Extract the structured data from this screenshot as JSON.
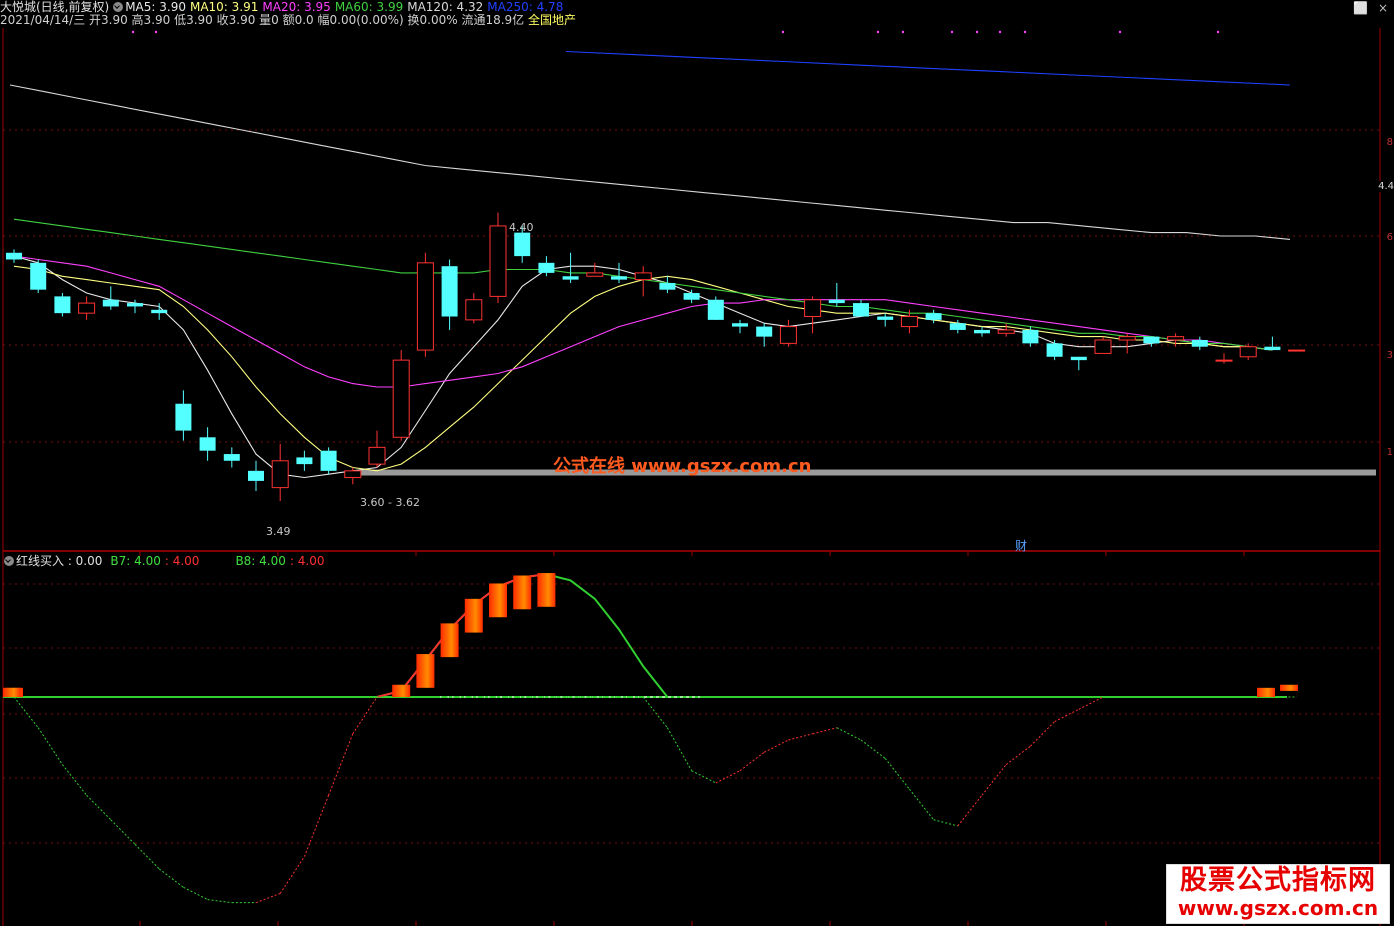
{
  "header": {
    "stock_name": "大悦城(日线,前复权)",
    "ma5": "MA5: 3.90",
    "ma10": "MA10: 3.91",
    "ma20": "MA20: 3.95",
    "ma60": "MA60: 3.99",
    "ma120": "MA120: 4.32",
    "ma250": "MA250: 4.78",
    "info_line": "2021/04/14/三 开3.90 高3.90 低3.90 收3.90 量0 额0.0 幅0.00(0.00%) 换0.00% 流通18.9亿",
    "sector": "全国地产"
  },
  "window_controls": {
    "restore": "⬜",
    "close": "×"
  },
  "price_annotations": {
    "high": "4.40",
    "low": "3.49",
    "range": "3.60 - 3.62",
    "current": "4.4",
    "finance_mark": "财"
  },
  "watermark": "公式在线  www.gszx.com.cn",
  "logo": {
    "line1": "股票公式指标网",
    "line2": "www.gszx.com.cn"
  },
  "indicator_header": {
    "name": "红线买入 : 0.00",
    "b7": "B7: 4.00",
    "b7_val": ": 4.00",
    "b8": "B8: 4.00",
    "b8_val": ": 4.00"
  },
  "right_ticks": [
    "8",
    "6",
    "3",
    "1"
  ],
  "colors": {
    "up": "#ff3232",
    "down": "#54ffff",
    "ma5": "#e8e8e8",
    "ma10": "#ffff80",
    "ma20": "#ff40ff",
    "ma60": "#40d040",
    "ma120": "#d8d8d8",
    "ma250": "#2040ff",
    "sector": "#ffff60"
  },
  "chart_data": {
    "type": "candlestick",
    "candles": [
      {
        "o": 4.28,
        "c": 4.26,
        "h": 4.29,
        "l": 4.25
      },
      {
        "o": 4.25,
        "c": 4.17,
        "h": 4.26,
        "l": 4.16
      },
      {
        "o": 4.15,
        "c": 4.1,
        "h": 4.16,
        "l": 4.09
      },
      {
        "o": 4.1,
        "c": 4.13,
        "h": 4.15,
        "l": 4.08
      },
      {
        "o": 4.14,
        "c": 4.12,
        "h": 4.18,
        "l": 4.11
      },
      {
        "o": 4.13,
        "c": 4.12,
        "h": 4.14,
        "l": 4.1
      },
      {
        "o": 4.11,
        "c": 4.1,
        "h": 4.13,
        "l": 4.08
      },
      {
        "o": 3.83,
        "c": 3.75,
        "h": 3.87,
        "l": 3.72
      },
      {
        "o": 3.73,
        "c": 3.69,
        "h": 3.76,
        "l": 3.66
      },
      {
        "o": 3.68,
        "c": 3.66,
        "h": 3.7,
        "l": 3.64
      },
      {
        "o": 3.63,
        "c": 3.6,
        "h": 3.66,
        "l": 3.57
      },
      {
        "o": 3.58,
        "c": 3.66,
        "h": 3.71,
        "l": 3.54
      },
      {
        "o": 3.67,
        "c": 3.65,
        "h": 3.69,
        "l": 3.63
      },
      {
        "o": 3.69,
        "c": 3.63,
        "h": 3.7,
        "l": 3.62
      },
      {
        "o": 3.61,
        "c": 3.63,
        "h": 3.64,
        "l": 3.59
      },
      {
        "o": 3.65,
        "c": 3.7,
        "h": 3.75,
        "l": 3.64
      },
      {
        "o": 3.73,
        "c": 3.96,
        "h": 3.99,
        "l": 3.72
      },
      {
        "o": 3.99,
        "c": 4.25,
        "h": 4.28,
        "l": 3.97
      },
      {
        "o": 4.24,
        "c": 4.09,
        "h": 4.26,
        "l": 4.05
      },
      {
        "o": 4.08,
        "c": 4.14,
        "h": 4.16,
        "l": 4.07
      },
      {
        "o": 4.15,
        "c": 4.36,
        "h": 4.4,
        "l": 4.13
      },
      {
        "o": 4.34,
        "c": 4.27,
        "h": 4.36,
        "l": 4.25
      },
      {
        "o": 4.25,
        "c": 4.22,
        "h": 4.27,
        "l": 4.21
      },
      {
        "o": 4.21,
        "c": 4.2,
        "h": 4.28,
        "l": 4.19
      },
      {
        "o": 4.21,
        "c": 4.22,
        "h": 4.25,
        "l": 4.21
      },
      {
        "o": 4.21,
        "c": 4.2,
        "h": 4.25,
        "l": 4.19
      },
      {
        "o": 4.2,
        "c": 4.22,
        "h": 4.24,
        "l": 4.15
      },
      {
        "o": 4.19,
        "c": 4.17,
        "h": 4.21,
        "l": 4.16
      },
      {
        "o": 4.16,
        "c": 4.14,
        "h": 4.17,
        "l": 4.13
      },
      {
        "o": 4.14,
        "c": 4.08,
        "h": 4.15,
        "l": 4.08
      },
      {
        "o": 4.07,
        "c": 4.06,
        "h": 4.08,
        "l": 4.04
      },
      {
        "o": 4.06,
        "c": 4.03,
        "h": 4.07,
        "l": 4.0
      },
      {
        "o": 4.01,
        "c": 4.06,
        "h": 4.08,
        "l": 4.0
      },
      {
        "o": 4.09,
        "c": 4.14,
        "h": 4.15,
        "l": 4.04
      },
      {
        "o": 4.14,
        "c": 4.13,
        "h": 4.19,
        "l": 4.12
      },
      {
        "o": 4.13,
        "c": 4.09,
        "h": 4.14,
        "l": 4.09
      },
      {
        "o": 4.09,
        "c": 4.08,
        "h": 4.1,
        "l": 4.06
      },
      {
        "o": 4.06,
        "c": 4.09,
        "h": 4.11,
        "l": 4.04
      },
      {
        "o": 4.1,
        "c": 4.08,
        "h": 4.11,
        "l": 4.07
      },
      {
        "o": 4.07,
        "c": 4.05,
        "h": 4.08,
        "l": 4.04
      },
      {
        "o": 4.05,
        "c": 4.04,
        "h": 4.06,
        "l": 4.03
      },
      {
        "o": 4.04,
        "c": 4.05,
        "h": 4.07,
        "l": 4.03
      },
      {
        "o": 4.05,
        "c": 4.01,
        "h": 4.06,
        "l": 4.0
      },
      {
        "o": 4.01,
        "c": 3.97,
        "h": 4.02,
        "l": 3.96
      },
      {
        "o": 3.97,
        "c": 3.96,
        "h": 3.97,
        "l": 3.93
      },
      {
        "o": 3.98,
        "c": 4.02,
        "h": 4.03,
        "l": 3.98
      },
      {
        "o": 4.02,
        "c": 4.03,
        "h": 4.04,
        "l": 3.98
      },
      {
        "o": 4.03,
        "c": 4.01,
        "h": 4.03,
        "l": 4.0
      },
      {
        "o": 4.02,
        "c": 4.03,
        "h": 4.04,
        "l": 4.0
      },
      {
        "o": 4.02,
        "c": 4.0,
        "h": 4.03,
        "l": 3.99
      },
      {
        "o": 3.96,
        "c": 3.96,
        "h": 3.98,
        "l": 3.95
      },
      {
        "o": 3.97,
        "c": 4.0,
        "h": 4.01,
        "l": 3.96
      },
      {
        "o": 4.0,
        "c": 3.99,
        "h": 4.03,
        "l": 3.99
      },
      {
        "o": 3.99,
        "c": 3.99,
        "h": 3.99,
        "l": 3.99
      }
    ],
    "ma_series": [
      {
        "name": "MA5",
        "values": [
          4.27,
          4.25,
          4.2,
          4.16,
          4.14,
          4.13,
          4.12,
          4.05,
          3.93,
          3.8,
          3.68,
          3.62,
          3.61,
          3.62,
          3.63,
          3.64,
          3.7,
          3.81,
          3.92,
          4.0,
          4.08,
          4.18,
          4.23,
          4.24,
          4.24,
          4.23,
          4.21,
          4.19,
          4.16,
          4.13,
          4.1,
          4.07,
          4.06,
          4.07,
          4.08,
          4.09,
          4.1,
          4.09,
          4.08,
          4.07,
          4.06,
          4.05,
          4.04,
          4.01,
          4.0,
          4.0,
          4.0,
          4.01,
          4.02,
          4.01,
          4.0,
          4.0,
          3.99
        ]
      },
      {
        "name": "MA10",
        "values": [
          4.24,
          4.23,
          4.21,
          4.2,
          4.19,
          4.18,
          4.17,
          4.12,
          4.05,
          3.97,
          3.88,
          3.8,
          3.73,
          3.67,
          3.64,
          3.63,
          3.65,
          3.7,
          3.76,
          3.82,
          3.89,
          3.96,
          4.03,
          4.1,
          4.15,
          4.18,
          4.2,
          4.21,
          4.2,
          4.18,
          4.16,
          4.14,
          4.12,
          4.11,
          4.1,
          4.1,
          4.1,
          4.09,
          4.08,
          4.07,
          4.06,
          4.06,
          4.05,
          4.04,
          4.03,
          4.03,
          4.02,
          4.02,
          4.01,
          4.01,
          4.0,
          4.0,
          3.99
        ]
      },
      {
        "name": "MA20",
        "values": [
          4.27,
          4.26,
          4.25,
          4.24,
          4.22,
          4.2,
          4.18,
          4.14,
          4.1,
          4.06,
          4.02,
          3.98,
          3.94,
          3.91,
          3.89,
          3.88,
          3.88,
          3.89,
          3.9,
          3.91,
          3.92,
          3.94,
          3.97,
          4.0,
          4.03,
          4.06,
          4.08,
          4.1,
          4.12,
          4.13,
          4.13,
          4.14,
          4.14,
          4.14,
          4.14,
          4.14,
          4.14,
          4.13,
          4.12,
          4.11,
          4.1,
          4.09,
          4.08,
          4.07,
          4.06,
          4.05,
          4.04,
          4.03,
          4.02,
          4.02,
          4.01,
          4.0,
          3.99
        ]
      },
      {
        "name": "MA60",
        "values": [
          4.38,
          4.37,
          4.36,
          4.35,
          4.34,
          4.33,
          4.32,
          4.31,
          4.3,
          4.29,
          4.28,
          4.27,
          4.26,
          4.25,
          4.24,
          4.23,
          4.22,
          4.22,
          4.22,
          4.22,
          4.23,
          4.23,
          4.23,
          4.22,
          4.22,
          4.21,
          4.2,
          4.19,
          4.18,
          4.17,
          4.16,
          4.15,
          4.14,
          4.13,
          4.12,
          4.12,
          4.11,
          4.1,
          4.1,
          4.09,
          4.08,
          4.07,
          4.06,
          4.05,
          4.04,
          4.04,
          4.03,
          4.03,
          4.02,
          4.01,
          4.01,
          4.0,
          3.99
        ]
      },
      {
        "name": "MA120",
        "values": [
          4.78,
          4.76,
          4.74,
          4.72,
          4.7,
          4.68,
          4.66,
          4.64,
          4.62,
          4.6,
          4.58,
          4.56,
          4.54,
          4.53,
          4.52,
          4.51,
          4.5,
          4.49,
          4.48,
          4.47,
          4.46,
          4.45,
          4.44,
          4.43,
          4.42,
          4.41,
          4.4,
          4.39,
          4.38,
          4.37,
          4.37,
          4.36,
          4.35,
          4.34,
          4.34,
          4.33,
          4.33,
          4.32
        ]
      },
      {
        "name": "MA250",
        "values": [
          4.88,
          4.87,
          4.86,
          4.85,
          4.84,
          4.83,
          4.82,
          4.81,
          4.8,
          4.79,
          4.78
        ]
      }
    ],
    "price_ylim": [
      3.4,
      4.95
    ],
    "support_line": 3.625,
    "indicator": {
      "green_upper": [
        0,
        0,
        0,
        0,
        0,
        0,
        0,
        0,
        0,
        0,
        0,
        0,
        0,
        0,
        0,
        0,
        0.1,
        0.6,
        1.1,
        1.5,
        1.8,
        1.95,
        2.0,
        1.9,
        1.6,
        1.1,
        0.5,
        0,
        0,
        0,
        0,
        0,
        0,
        0,
        0,
        0,
        0,
        0,
        0,
        0,
        0,
        0,
        0,
        0,
        0,
        0,
        0,
        0,
        0,
        0,
        0,
        0,
        0.1,
        0.15
      ],
      "lower": [
        0,
        -0.5,
        -1.1,
        -1.6,
        -2.0,
        -2.4,
        -2.8,
        -3.1,
        -3.3,
        -3.35,
        -3.35,
        -3.2,
        -2.6,
        -1.6,
        -0.6,
        0,
        0,
        0,
        0,
        0,
        0,
        0,
        0,
        0,
        0,
        0,
        0,
        -0.5,
        -1.2,
        -1.4,
        -1.2,
        -0.9,
        -0.7,
        -0.6,
        -0.5,
        -0.7,
        -1.0,
        -1.5,
        -2.0,
        -2.1,
        -1.6,
        -1.1,
        -0.8,
        -0.4,
        -0.2,
        0,
        0,
        0,
        0,
        0,
        0,
        0,
        0,
        0
      ],
      "bars": [
        0.15,
        0,
        0,
        0,
        0,
        0,
        0,
        0,
        0,
        0,
        0,
        0,
        0,
        0,
        0,
        0,
        0.2,
        0.7,
        1.2,
        1.6,
        1.85,
        1.98,
        2.02
      ],
      "ylim": [
        -3.6,
        2.2
      ]
    }
  }
}
